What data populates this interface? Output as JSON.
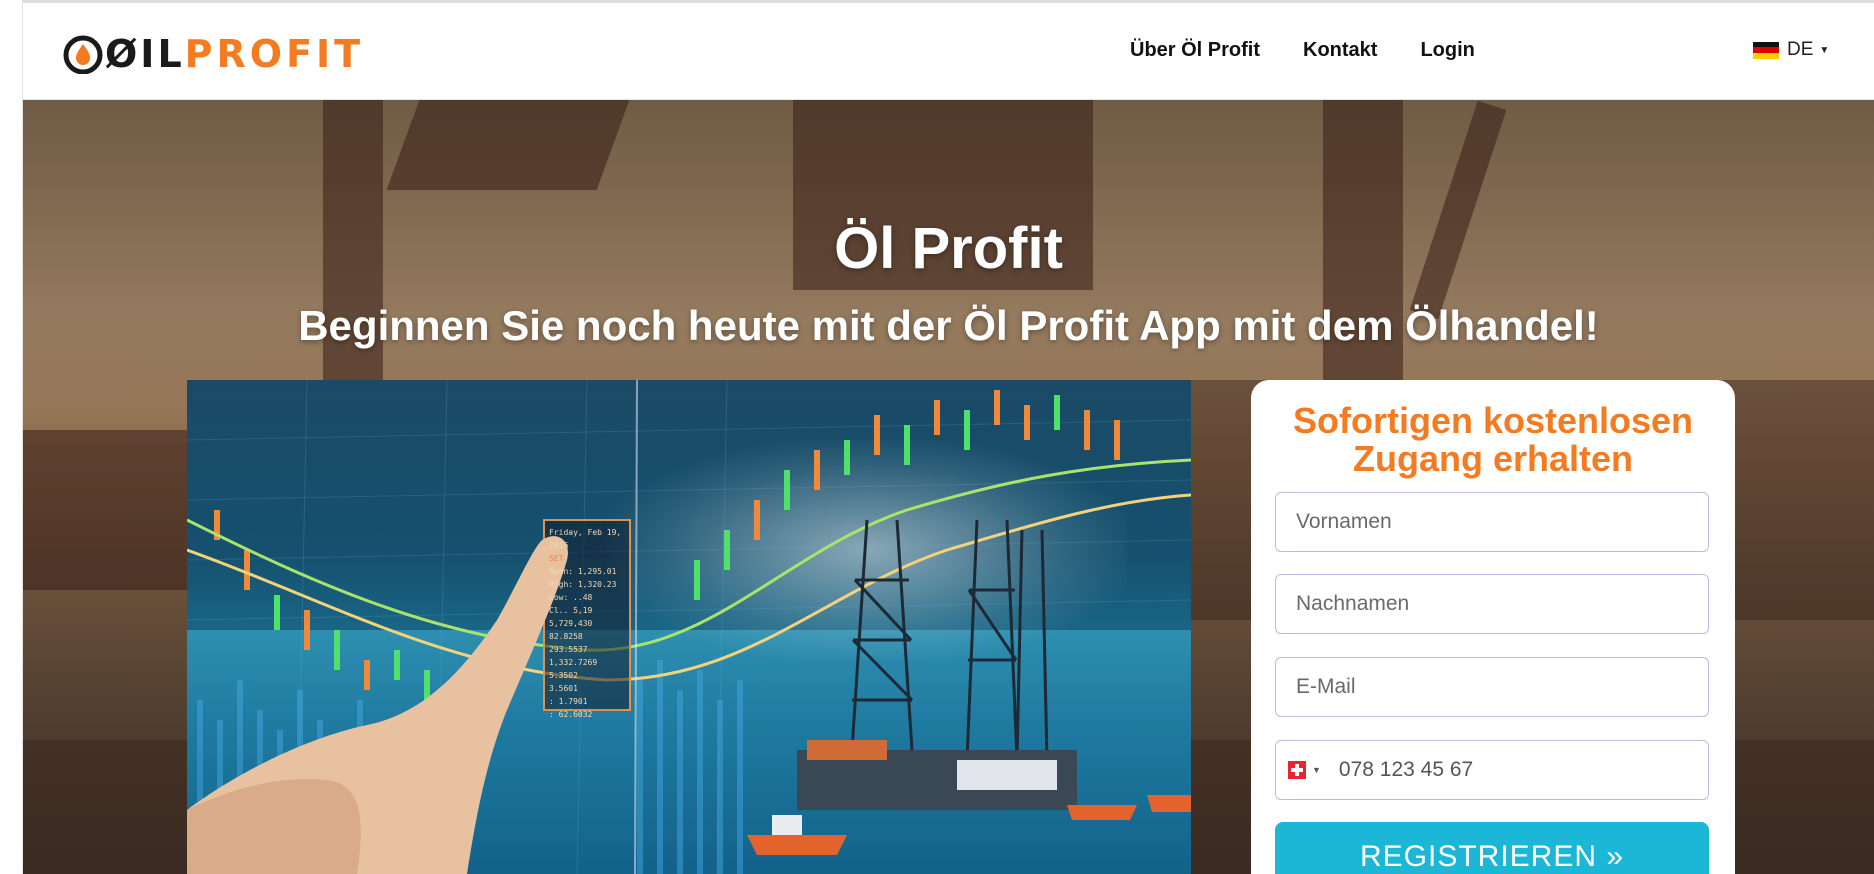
{
  "header": {
    "logo": {
      "part_a": "ØIL",
      "part_b": "PROFIT",
      "brand_color": "#f47b20"
    },
    "nav": [
      {
        "label": "Über Öl Profit"
      },
      {
        "label": "Kontakt"
      },
      {
        "label": "Login"
      }
    ],
    "language": {
      "label": "DE",
      "flag": "germany-flag-icon"
    }
  },
  "hero": {
    "title": "Öl Profit",
    "subtitle": "Beginnen Sie noch heute mit der Öl Profit App mit dem Ölhandel!"
  },
  "media": {
    "chart_overlay": {
      "date": "Friday, Feb 19, 2016",
      "symbol": "SET",
      "open": "Open: 1,295.01",
      "high": "High: 1,320.23",
      "row3": "Low: ..48",
      "row4": "Cl.. 5,19",
      "row5": "5,729,430",
      "row6": "82.8258",
      "row7": "293.5537",
      "row8": "1,332.7269",
      "row9": "5.3502",
      "row10": "3.5601",
      "row11": ": 1.7901",
      "row12": ": 62.6032"
    }
  },
  "form": {
    "title": "Sofortigen kostenlosen Zugang erhalten",
    "first_name_placeholder": "Vornamen",
    "last_name_placeholder": "Nachnamen",
    "email_placeholder": "E-Mail",
    "phone_placeholder": "078 123 45 67",
    "phone_country_flag": "switzerland-flag-icon",
    "submit_label": "REGISTRIEREN »",
    "accent_color": "#1cb6d6"
  }
}
